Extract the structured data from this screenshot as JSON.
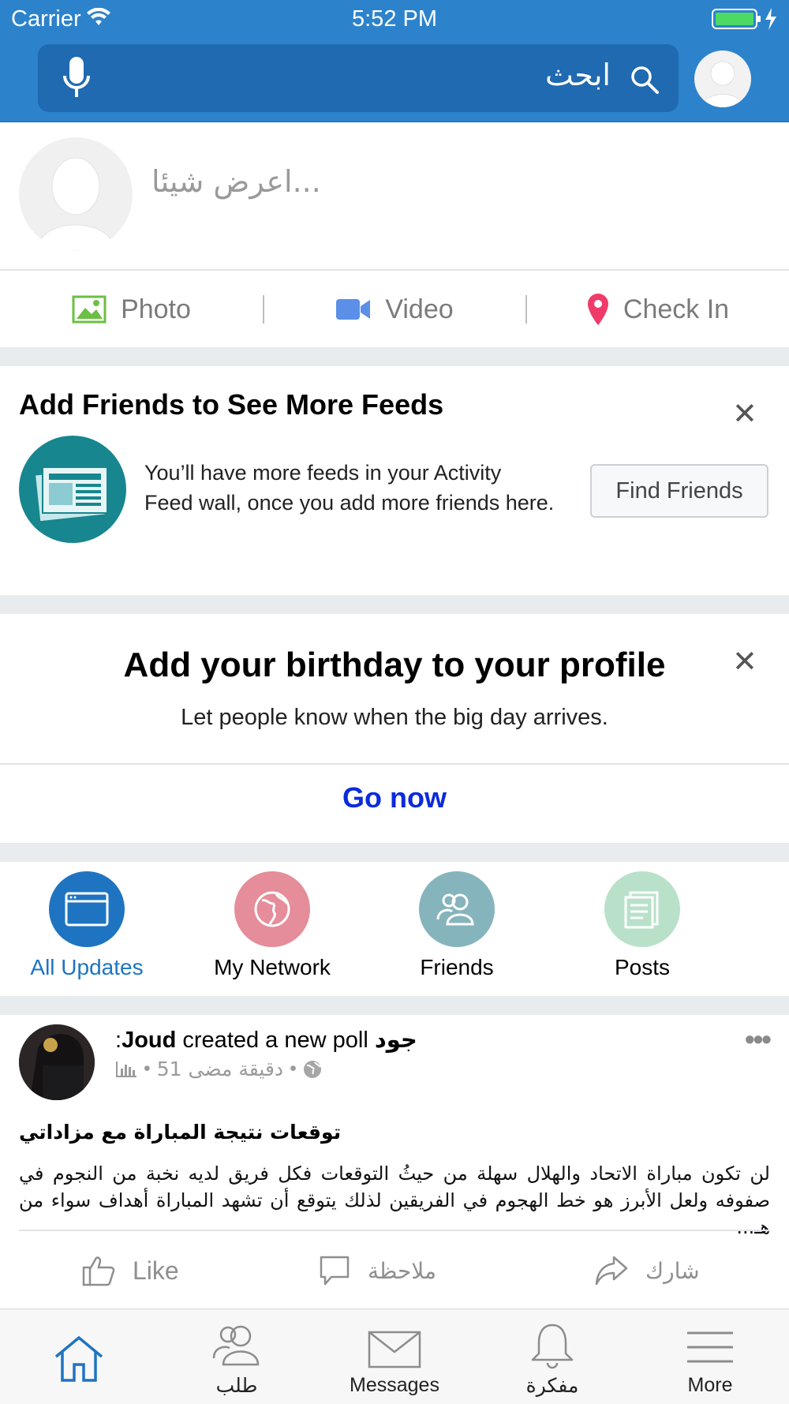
{
  "status_bar": {
    "carrier": "Carrier",
    "time": "5:52 PM"
  },
  "header": {
    "search_label": "ابحث"
  },
  "composer": {
    "placeholder": "اعرض شيئا..."
  },
  "media_actions": {
    "photo": "Photo",
    "video": "Video",
    "checkin": "Check In"
  },
  "add_friends_card": {
    "title": "Add Friends to See More Feeds",
    "text": "You’ll have more feeds in your Activity Feed wall, once you add more friends here.",
    "button": "Find Friends"
  },
  "birthday_card": {
    "title": "Add your birthday to your profile",
    "subtitle": "Let people know when the big day arrives.",
    "link": "Go now"
  },
  "feed_tabs": [
    {
      "label": "All Updates",
      "active": true
    },
    {
      "label": "My Network"
    },
    {
      "label": "Friends"
    },
    {
      "label": "Posts"
    }
  ],
  "post": {
    "author_prefix": ":",
    "author": "Joud",
    "action": " created a new poll ",
    "author_ar": "جود",
    "time": "51 دقيقة مضى",
    "dot": "•",
    "subject": "توقعات  نتيجة المباراة مع مزاداتي",
    "body": "لن تكون مباراة الاتحاد والهلال سهلة من حيثُ التوقعات فكل فريق لديه نخبة من النجوم في صفوفه ولعل الأبرز هو خط الهجوم في الفريقين لذلك يتوقع أن تشهد المباراة أهداف سواء من هـ...",
    "actions": {
      "like": "Like",
      "comment": "ملاحظة",
      "share": "شارك"
    }
  },
  "bottom_nav": [
    {
      "label": ""
    },
    {
      "label": "طلب"
    },
    {
      "label": "Messages"
    },
    {
      "label": "مفكرة"
    },
    {
      "label": "More"
    }
  ],
  "colors": {
    "header_blue": "#2c83cb",
    "active_blue": "#1e74c1",
    "link_blue": "#0b2bdb"
  }
}
